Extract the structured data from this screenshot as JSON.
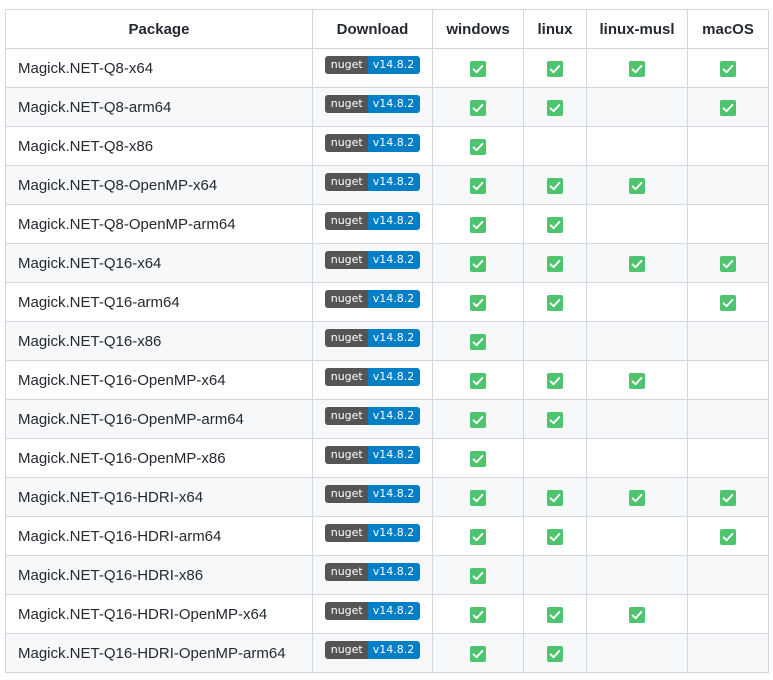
{
  "headers": [
    "Package",
    "Download",
    "windows",
    "linux",
    "linux-musl",
    "macOS"
  ],
  "badge": {
    "label": "nuget",
    "value": "v14.8.2"
  },
  "check_icon": "white-check-mark-icon",
  "colors": {
    "badge_label_bg": "#555555",
    "badge_value_bg": "#007ec6",
    "check_bg": "#4fc46f",
    "border": "#d0d7de",
    "stripe": "#f6f8fa"
  },
  "rows": [
    {
      "package": "Magick.NET-Q8-x64",
      "windows": true,
      "linux": true,
      "linux_musl": true,
      "macos": true
    },
    {
      "package": "Magick.NET-Q8-arm64",
      "windows": true,
      "linux": true,
      "linux_musl": false,
      "macos": true
    },
    {
      "package": "Magick.NET-Q8-x86",
      "windows": true,
      "linux": false,
      "linux_musl": false,
      "macos": false
    },
    {
      "package": "Magick.NET-Q8-OpenMP-x64",
      "windows": true,
      "linux": true,
      "linux_musl": true,
      "macos": false
    },
    {
      "package": "Magick.NET-Q8-OpenMP-arm64",
      "windows": true,
      "linux": true,
      "linux_musl": false,
      "macos": false
    },
    {
      "package": "Magick.NET-Q16-x64",
      "windows": true,
      "linux": true,
      "linux_musl": true,
      "macos": true
    },
    {
      "package": "Magick.NET-Q16-arm64",
      "windows": true,
      "linux": true,
      "linux_musl": false,
      "macos": true
    },
    {
      "package": "Magick.NET-Q16-x86",
      "windows": true,
      "linux": false,
      "linux_musl": false,
      "macos": false
    },
    {
      "package": "Magick.NET-Q16-OpenMP-x64",
      "windows": true,
      "linux": true,
      "linux_musl": true,
      "macos": false
    },
    {
      "package": "Magick.NET-Q16-OpenMP-arm64",
      "windows": true,
      "linux": true,
      "linux_musl": false,
      "macos": false
    },
    {
      "package": "Magick.NET-Q16-OpenMP-x86",
      "windows": true,
      "linux": false,
      "linux_musl": false,
      "macos": false
    },
    {
      "package": "Magick.NET-Q16-HDRI-x64",
      "windows": true,
      "linux": true,
      "linux_musl": true,
      "macos": true
    },
    {
      "package": "Magick.NET-Q16-HDRI-arm64",
      "windows": true,
      "linux": true,
      "linux_musl": false,
      "macos": true
    },
    {
      "package": "Magick.NET-Q16-HDRI-x86",
      "windows": true,
      "linux": false,
      "linux_musl": false,
      "macos": false
    },
    {
      "package": "Magick.NET-Q16-HDRI-OpenMP-x64",
      "windows": true,
      "linux": true,
      "linux_musl": true,
      "macos": false
    },
    {
      "package": "Magick.NET-Q16-HDRI-OpenMP-arm64",
      "windows": true,
      "linux": true,
      "linux_musl": false,
      "macos": false
    }
  ]
}
